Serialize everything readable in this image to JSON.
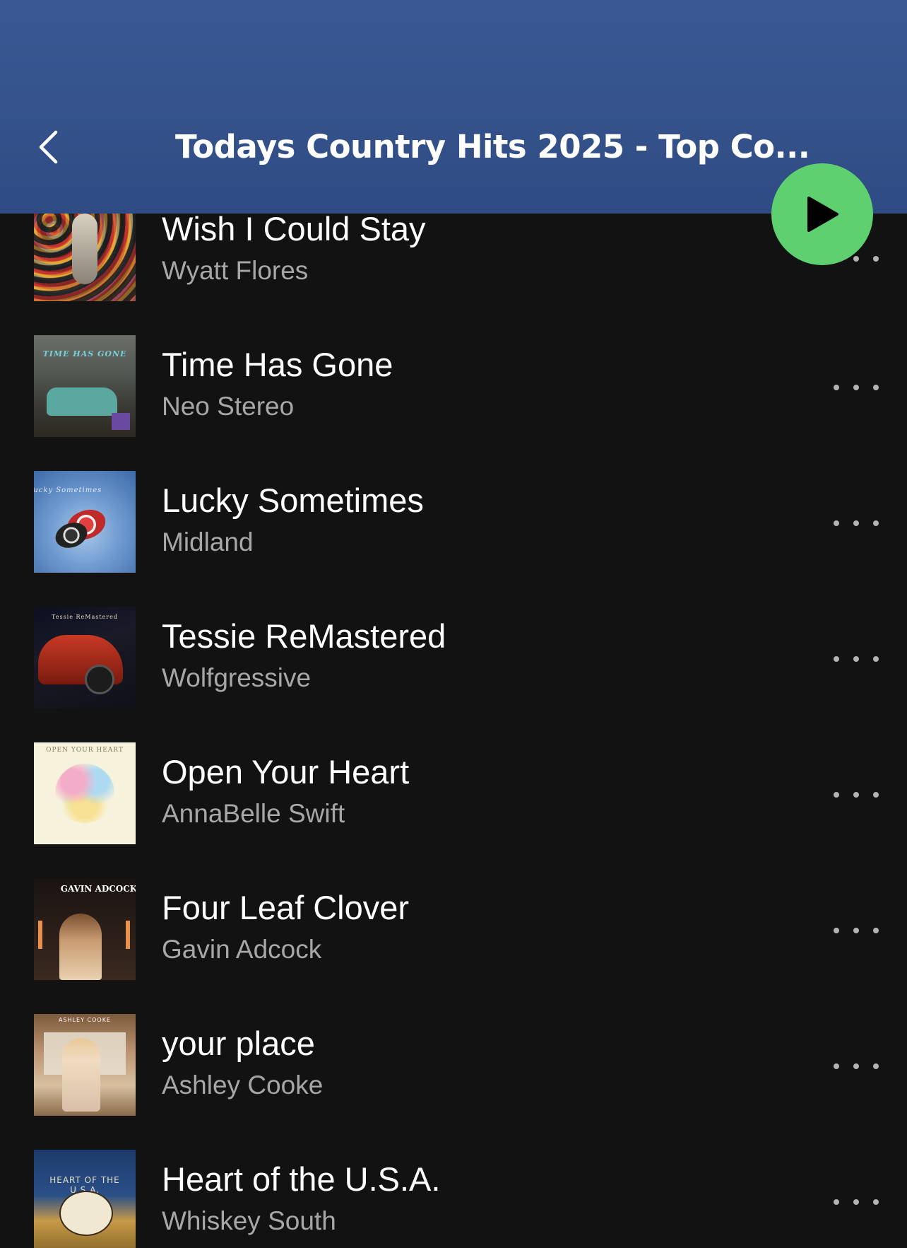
{
  "header": {
    "title": "Todays Country Hits 2025 - Top Co...",
    "back_icon": "chevron-left-icon",
    "play_icon": "play-icon",
    "colors": {
      "header_bg": "#3a5894",
      "play_bg": "#5fd070",
      "background": "#121212"
    }
  },
  "tracks": [
    {
      "title": "Wish I Could Stay",
      "artist": "Wyatt Flores",
      "art_text": ""
    },
    {
      "title": "Time Has Gone",
      "artist": "Neo Stereo",
      "art_text": "TIME HAS GONE"
    },
    {
      "title": "Lucky Sometimes",
      "artist": "Midland",
      "art_text": "Lucky Sometimes"
    },
    {
      "title": "Tessie ReMastered",
      "artist": "Wolfgressive",
      "art_text": "Tessie ReMastered"
    },
    {
      "title": "Open Your Heart",
      "artist": "AnnaBelle Swift",
      "art_text": "OPEN YOUR HEART"
    },
    {
      "title": "Four Leaf Clover",
      "artist": "Gavin Adcock",
      "art_text": "GAVIN ADCOCK"
    },
    {
      "title": "your place",
      "artist": "Ashley Cooke",
      "art_text": "ASHLEY COOKE"
    },
    {
      "title": "Heart of the U.S.A.",
      "artist": "Whiskey South",
      "art_text": "HEART OF THE U.S.A."
    }
  ]
}
